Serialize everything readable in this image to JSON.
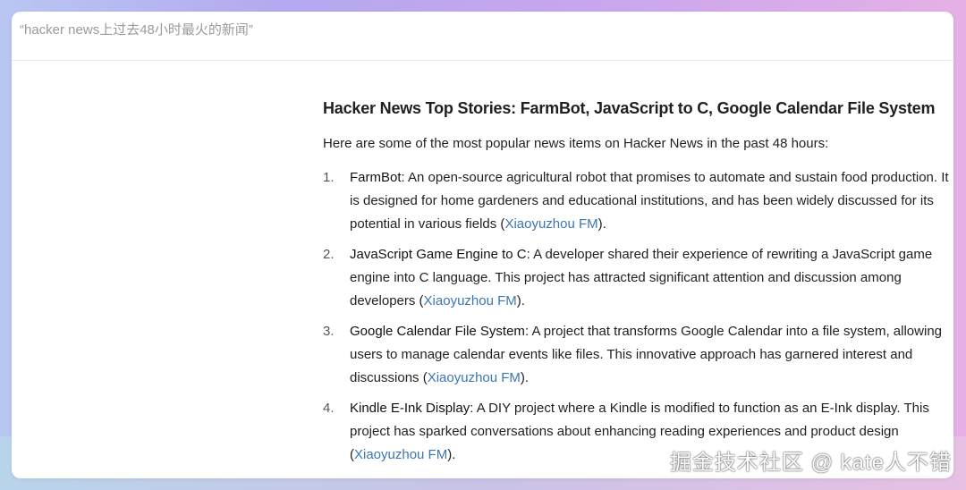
{
  "query": "“hacker news上过去48小时最火的新闻”",
  "title": "Hacker News Top Stories: FarmBot, JavaScript to C, Google Calendar File System",
  "intro": "Here are some of the most popular news items on Hacker News in the past 48 hours:",
  "items": [
    {
      "num": "1.",
      "name": "FarmBot",
      "text": ": An open-source agricultural robot that promises to automate and sustain food production. It is designed for home gardeners and educational institutions, and has been widely discussed for its potential in various fields (",
      "link": "Xiaoyuzhou FM",
      "end": ")."
    },
    {
      "num": "2.",
      "name": "JavaScript Game Engine to C",
      "text": ": A developer shared their experience of rewriting a JavaScript game engine into C language. This project has attracted significant attention and discussion among developers (",
      "link": "Xiaoyuzhou FM",
      "end": ")."
    },
    {
      "num": "3.",
      "name": "Google Calendar File System",
      "text": ": A project that transforms Google Calendar into a file system, allowing users to manage calendar events like files. This innovative approach has garnered interest and discussions (",
      "link": "Xiaoyuzhou FM",
      "end": ")."
    },
    {
      "num": "4.",
      "name": "Kindle E-Ink Display",
      "text": ": A DIY project where a Kindle is modified to function as an E-Ink display. This project has sparked conversations about enhancing reading experiences and product design (",
      "link": "Xiaoyuzhou FM",
      "end": ")."
    }
  ],
  "watermark": "掘金技术社区 @ kate人不错"
}
